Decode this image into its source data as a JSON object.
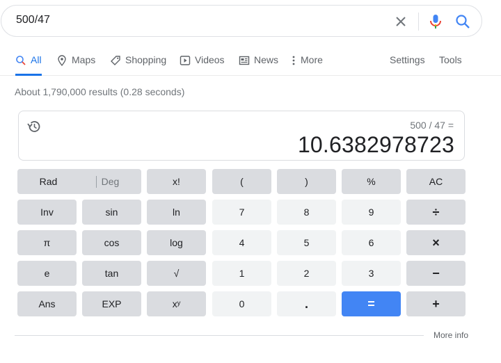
{
  "search": {
    "query": "500/47"
  },
  "tabs": {
    "items": [
      {
        "label": "All",
        "icon": "search-icon"
      },
      {
        "label": "Maps",
        "icon": "map-pin-icon"
      },
      {
        "label": "Shopping",
        "icon": "tag-icon"
      },
      {
        "label": "Videos",
        "icon": "play-icon"
      },
      {
        "label": "News",
        "icon": "newspaper-icon"
      },
      {
        "label": "More",
        "icon": "more-vert-icon"
      }
    ],
    "settings": "Settings",
    "tools": "Tools"
  },
  "stats": "About 1,790,000 results (0.28 seconds)",
  "calculator": {
    "expression": "500 / 47 =",
    "result": "10.6382978723",
    "mode": {
      "rad": "Rad",
      "deg": "Deg"
    },
    "keys": {
      "fact": "x!",
      "lparen": "(",
      "rparen": ")",
      "percent": "%",
      "ac": "AC",
      "inv": "Inv",
      "sin": "sin",
      "ln": "ln",
      "k7": "7",
      "k8": "8",
      "k9": "9",
      "divide": "÷",
      "pi": "π",
      "cos": "cos",
      "log": "log",
      "k4": "4",
      "k5": "5",
      "k6": "6",
      "multiply": "×",
      "e": "e",
      "tan": "tan",
      "sqrt": "√",
      "k1": "1",
      "k2": "2",
      "k3": "3",
      "minus": "−",
      "ans": "Ans",
      "exp": "EXP",
      "pow": "xʸ",
      "k0": "0",
      "dot": ".",
      "equals": "=",
      "plus": "+"
    }
  },
  "footer": {
    "more_info": "More info"
  },
  "colors": {
    "accent": "#1a73e8",
    "equals_key": "#4285f4",
    "fn_key": "#dadce0",
    "num_key": "#f1f3f4"
  }
}
